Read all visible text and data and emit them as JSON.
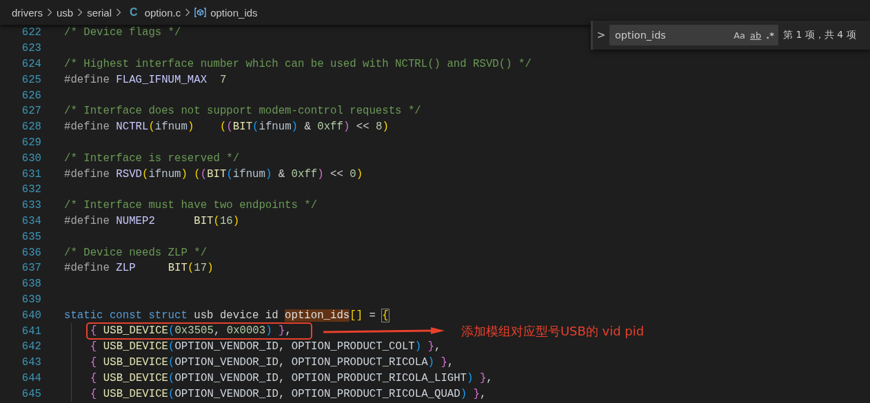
{
  "breadcrumb": [
    {
      "kind": "folder",
      "label": "drivers"
    },
    {
      "kind": "folder",
      "label": "usb"
    },
    {
      "kind": "folder",
      "label": "serial"
    },
    {
      "kind": "file",
      "icon_text": "C",
      "label": "option.c"
    },
    {
      "kind": "symbol",
      "label": "option_ids"
    }
  ],
  "find_widget": {
    "toggle_label": ">",
    "value": "option_ids",
    "options": [
      "Aa",
      "ab",
      ".*"
    ],
    "result": "第 1 项，共 4 项"
  },
  "lines": [
    {
      "number": "622",
      "tokens": [
        {
          "kind": "comment",
          "text": "/* Device flags */"
        }
      ]
    },
    {
      "number": "623"
    },
    {
      "number": "624",
      "tokens": [
        {
          "kind": "comment",
          "text": "/* Highest interface number which can be used with NCTRL() and RSVD() */"
        }
      ]
    },
    {
      "number": "625",
      "tokens": [
        {
          "kind": "directive",
          "text": "#define "
        },
        {
          "kind": "macro",
          "text": "FLAG_IFNUM_MAX"
        },
        {
          "kind": "number",
          "text": "  7"
        }
      ]
    },
    {
      "number": "626"
    },
    {
      "number": "627",
      "tokens": [
        {
          "kind": "comment",
          "text": "/* Interface does not support modem-control requests */"
        }
      ]
    },
    {
      "number": "628",
      "tokens": [
        {
          "kind": "directive",
          "text": "#define "
        },
        {
          "kind": "macro",
          "text": "NCTRL"
        },
        {
          "kind": "b1",
          "text": "("
        },
        {
          "kind": "param",
          "text": "ifnum"
        },
        {
          "kind": "b1",
          "text": ")"
        },
        {
          "kind": "b1",
          "text": "    ("
        },
        {
          "kind": "b2",
          "text": "("
        },
        {
          "kind": "fn",
          "text": "BIT"
        },
        {
          "kind": "b3",
          "text": "("
        },
        {
          "kind": "param",
          "text": "ifnum"
        },
        {
          "kind": "b3",
          "text": ")"
        },
        {
          "kind": "text",
          "text": " & "
        },
        {
          "kind": "number",
          "text": "0xff"
        },
        {
          "kind": "b2",
          "text": ")"
        },
        {
          "kind": "text",
          "text": " << "
        },
        {
          "kind": "number",
          "text": "8"
        },
        {
          "kind": "b1",
          "text": ")"
        }
      ]
    },
    {
      "number": "629"
    },
    {
      "number": "630",
      "tokens": [
        {
          "kind": "comment",
          "text": "/* Interface is reserved */"
        }
      ]
    },
    {
      "number": "631",
      "tokens": [
        {
          "kind": "directive",
          "text": "#define "
        },
        {
          "kind": "macro",
          "text": "RSVD"
        },
        {
          "kind": "b1",
          "text": "("
        },
        {
          "kind": "param",
          "text": "ifnum"
        },
        {
          "kind": "b1",
          "text": ")"
        },
        {
          "kind": "b1",
          "text": " ("
        },
        {
          "kind": "b2",
          "text": "("
        },
        {
          "kind": "fn",
          "text": "BIT"
        },
        {
          "kind": "b3",
          "text": "("
        },
        {
          "kind": "param",
          "text": "ifnum"
        },
        {
          "kind": "b3",
          "text": ")"
        },
        {
          "kind": "text",
          "text": " & "
        },
        {
          "kind": "number",
          "text": "0xff"
        },
        {
          "kind": "b2",
          "text": ")"
        },
        {
          "kind": "text",
          "text": " << "
        },
        {
          "kind": "number",
          "text": "0"
        },
        {
          "kind": "b1",
          "text": ")"
        }
      ]
    },
    {
      "number": "632"
    },
    {
      "number": "633",
      "tokens": [
        {
          "kind": "comment",
          "text": "/* Interface must have two endpoints */"
        }
      ]
    },
    {
      "number": "634",
      "tokens": [
        {
          "kind": "directive",
          "text": "#define "
        },
        {
          "kind": "macro",
          "text": "NUMEP2"
        },
        {
          "kind": "fn",
          "text": "      BIT"
        },
        {
          "kind": "b1",
          "text": "("
        },
        {
          "kind": "number",
          "text": "16"
        },
        {
          "kind": "b1",
          "text": ")"
        }
      ]
    },
    {
      "number": "635"
    },
    {
      "number": "636",
      "tokens": [
        {
          "kind": "comment",
          "text": "/* Device needs ZLP */"
        }
      ]
    },
    {
      "number": "637",
      "tokens": [
        {
          "kind": "directive",
          "text": "#define "
        },
        {
          "kind": "macro",
          "text": "ZLP"
        },
        {
          "kind": "fn",
          "text": "     BIT"
        },
        {
          "kind": "b1",
          "text": "("
        },
        {
          "kind": "number",
          "text": "17"
        },
        {
          "kind": "b1",
          "text": ")"
        }
      ]
    },
    {
      "number": "638"
    },
    {
      "number": "639"
    },
    {
      "number": "640",
      "tokens": [
        {
          "kind": "keyword",
          "text": "static const struct"
        },
        {
          "kind": "text",
          "text": " usb device id "
        },
        {
          "kind": "match",
          "text": "option_ids"
        },
        {
          "kind": "b1",
          "text": "[]"
        },
        {
          "kind": "text",
          "text": " = "
        },
        {
          "kind": "bracketmatch",
          "text": "{"
        }
      ]
    },
    {
      "number": "641",
      "indented": true,
      "boxed": true,
      "note": "添加模组对应型号USB的 vid pid",
      "tokens": [
        {
          "kind": "b2",
          "text": "{"
        },
        {
          "kind": "fn",
          "text": " USB_DEVICE"
        },
        {
          "kind": "b3",
          "text": "("
        },
        {
          "kind": "number",
          "text": "0x3505"
        },
        {
          "kind": "text",
          "text": ", "
        },
        {
          "kind": "number",
          "text": "0x0003"
        },
        {
          "kind": "b3",
          "text": ")"
        },
        {
          "kind": "b2",
          "text": " }"
        },
        {
          "kind": "text",
          "text": ","
        }
      ]
    },
    {
      "number": "642",
      "indented": true,
      "tokens": [
        {
          "kind": "b2",
          "text": "{"
        },
        {
          "kind": "fn",
          "text": " USB_DEVICE"
        },
        {
          "kind": "b3",
          "text": "("
        },
        {
          "kind": "ident",
          "text": "OPTION_VENDOR_ID"
        },
        {
          "kind": "text",
          "text": ", "
        },
        {
          "kind": "ident",
          "text": "OPTION_PRODUCT_COLT"
        },
        {
          "kind": "b3",
          "text": ")"
        },
        {
          "kind": "b2",
          "text": " }"
        },
        {
          "kind": "text",
          "text": ","
        }
      ]
    },
    {
      "number": "643",
      "indented": true,
      "tokens": [
        {
          "kind": "b2",
          "text": "{"
        },
        {
          "kind": "fn",
          "text": " USB_DEVICE"
        },
        {
          "kind": "b3",
          "text": "("
        },
        {
          "kind": "ident",
          "text": "OPTION_VENDOR_ID"
        },
        {
          "kind": "text",
          "text": ", "
        },
        {
          "kind": "ident",
          "text": "OPTION_PRODUCT_RICOLA"
        },
        {
          "kind": "b3",
          "text": ")"
        },
        {
          "kind": "b2",
          "text": " }"
        },
        {
          "kind": "text",
          "text": ","
        }
      ]
    },
    {
      "number": "644",
      "indented": true,
      "tokens": [
        {
          "kind": "b2",
          "text": "{"
        },
        {
          "kind": "fn",
          "text": " USB_DEVICE"
        },
        {
          "kind": "b3",
          "text": "("
        },
        {
          "kind": "ident",
          "text": "OPTION_VENDOR_ID"
        },
        {
          "kind": "text",
          "text": ", "
        },
        {
          "kind": "ident",
          "text": "OPTION_PRODUCT_RICOLA_LIGHT"
        },
        {
          "kind": "b3",
          "text": ")"
        },
        {
          "kind": "b2",
          "text": " }"
        },
        {
          "kind": "text",
          "text": ","
        }
      ]
    },
    {
      "number": "645",
      "indented": true,
      "tokens": [
        {
          "kind": "b2",
          "text": "{"
        },
        {
          "kind": "fn",
          "text": " USB_DEVICE"
        },
        {
          "kind": "b3",
          "text": "("
        },
        {
          "kind": "ident",
          "text": "OPTION_VENDOR_ID"
        },
        {
          "kind": "text",
          "text": ", "
        },
        {
          "kind": "ident",
          "text": "OPTION_PRODUCT_RICOLA_QUAD"
        },
        {
          "kind": "b3",
          "text": ")"
        },
        {
          "kind": "b2",
          "text": " }"
        },
        {
          "kind": "text",
          "text": ","
        }
      ]
    }
  ]
}
